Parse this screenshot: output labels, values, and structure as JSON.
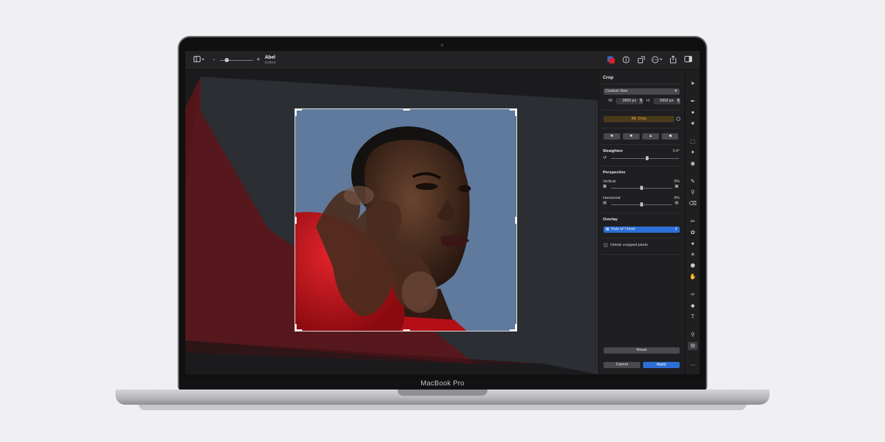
{
  "device": {
    "brand": "MacBook Pro"
  },
  "toolbar": {
    "doc_title": "Abel",
    "doc_subtitle": "Edited",
    "zoom_minus": "-",
    "zoom_plus": "+",
    "zoom_level": 0.2
  },
  "panel": {
    "title": "Crop",
    "size_preset": "Custom Size",
    "width_label": "W:",
    "width_value": "2893 px",
    "height_label": "H:",
    "height_value": "2902 px",
    "ml_crop_label": "ML Crop",
    "straighten": {
      "label": "Straighten",
      "value": "3.4°",
      "level": 0.53
    },
    "perspective": {
      "title": "Perspective",
      "vertical": {
        "label": "Vertical",
        "value": "0%",
        "level": 0.5
      },
      "horizontal": {
        "label": "Horizontal",
        "value": "0%",
        "level": 0.5
      }
    },
    "overlay": {
      "title": "Overlay",
      "selected": "Rule of Thirds"
    },
    "delete_cropped_label": "Delete cropped pixels",
    "delete_cropped_checked": false,
    "reset_label": "Reset",
    "cancel_label": "Cancel",
    "apply_label": "Apply"
  },
  "colors": {
    "accent_blue": "#2c6fd6",
    "ml_crop_text": "#f2b23a",
    "ml_crop_bg": "#4a3a1c",
    "photo_sky": "#5f7a9c",
    "photo_red": "#c8121a"
  }
}
